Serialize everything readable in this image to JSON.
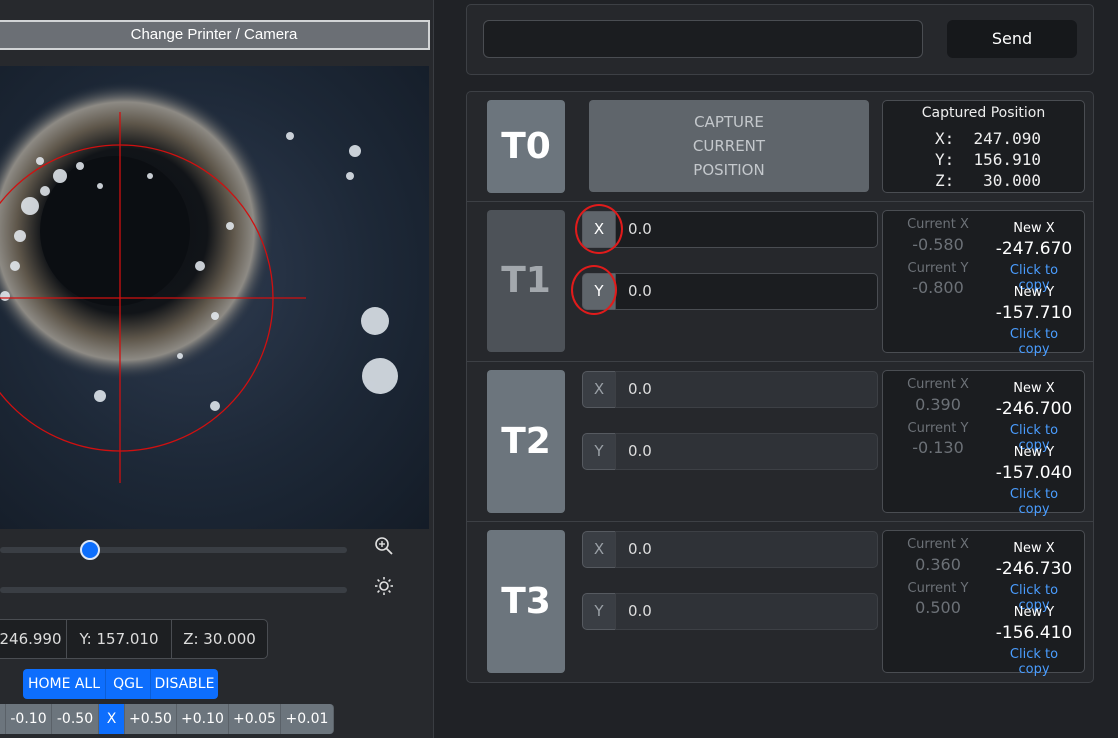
{
  "left": {
    "change_button": "Change Printer / Camera",
    "position": {
      "x": "246.990",
      "y": "Y: 157.010",
      "z": "Z: 30.000"
    },
    "home_buttons": [
      "HOME ALL",
      "QGL",
      "DISABLE"
    ],
    "jog_buttons": [
      "",
      "-0.10",
      "-0.50",
      "X",
      "+0.50",
      "+0.10",
      "+0.05",
      "+0.01"
    ],
    "zoom_level": 0.26,
    "icons": {
      "zoom": "zoom-in-icon",
      "brightness": "sun-icon"
    }
  },
  "command": {
    "value": "",
    "placeholder": "",
    "send_label": "Send"
  },
  "tools": [
    {
      "name": "T0",
      "capture_label": [
        "CAPTURE",
        "CURRENT",
        "POSITION"
      ],
      "captured": {
        "title": "Captured Position",
        "x_label": "X:",
        "x": "247.090",
        "y_label": "Y:",
        "y": "156.910",
        "z_label": "Z:",
        "z": "30.000"
      }
    },
    {
      "name": "T1",
      "x_btn": "X",
      "y_btn": "Y",
      "x_value": "0.0",
      "y_value": "0.0",
      "current_x_label": "Current X",
      "current_x": "-0.580",
      "current_y_label": "Current Y",
      "current_y": "-0.800",
      "new_x_label": "New X",
      "new_x": "-247.670",
      "new_y_label": "New Y",
      "new_y": "-157.710",
      "copy_label": "Click to copy"
    },
    {
      "name": "T2",
      "x_btn": "X",
      "y_btn": "Y",
      "x_value": "0.0",
      "y_value": "0.0",
      "current_x_label": "Current X",
      "current_x": "0.390",
      "current_y_label": "Current Y",
      "current_y": "-0.130",
      "new_x_label": "New X",
      "new_x": "-246.700",
      "new_y_label": "New Y",
      "new_y": "-157.040",
      "copy_label": "Click to copy"
    },
    {
      "name": "T3",
      "x_btn": "X",
      "y_btn": "Y",
      "x_value": "0.0",
      "y_value": "0.0",
      "current_x_label": "Current X",
      "current_x": "0.360",
      "current_y_label": "Current Y",
      "current_y": "0.500",
      "new_x_label": "New X",
      "new_x": "-246.730",
      "new_y_label": "New Y",
      "new_y": "-156.410",
      "copy_label": "Click to copy"
    }
  ],
  "colors": {
    "accent": "#0d6efd",
    "annotation": "#e01b1b",
    "crosshair": "#d01010",
    "link": "#4a9dff"
  }
}
